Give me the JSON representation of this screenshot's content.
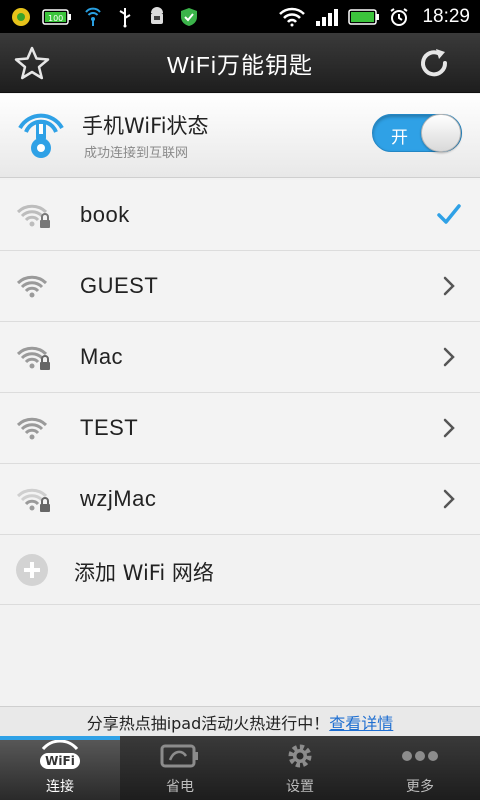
{
  "status_bar": {
    "time": "18:29",
    "battery_label": "100"
  },
  "header": {
    "title": "WiFi万能钥匙"
  },
  "wifi_status": {
    "heading": "手机WiFi状态",
    "subtitle": "成功连接到互联网",
    "toggle_label": "开"
  },
  "networks": [
    {
      "ssid": "book",
      "locked": true,
      "connected": true
    },
    {
      "ssid": "GUEST",
      "locked": false,
      "connected": false
    },
    {
      "ssid": "Mac",
      "locked": true,
      "connected": false
    },
    {
      "ssid": "TEST",
      "locked": false,
      "connected": false
    },
    {
      "ssid": "wzjMac",
      "locked": true,
      "connected": false
    }
  ],
  "add_network": {
    "label": "添加 WiFi 网络"
  },
  "banner": {
    "text": "分享热点抽ipad活动火热进行中！",
    "link": "查看详情"
  },
  "bottom_nav": {
    "tabs": [
      {
        "label": "连接",
        "active": true
      },
      {
        "label": "省电",
        "active": false
      },
      {
        "label": "设置",
        "active": false
      },
      {
        "label": "更多",
        "active": false
      }
    ]
  },
  "colors": {
    "accent": "#2fa1e6",
    "link": "#1f6fd1",
    "titlebar": "#2a2a2a"
  },
  "icons": {
    "header_left": "star-icon",
    "header_right": "refresh-icon"
  }
}
